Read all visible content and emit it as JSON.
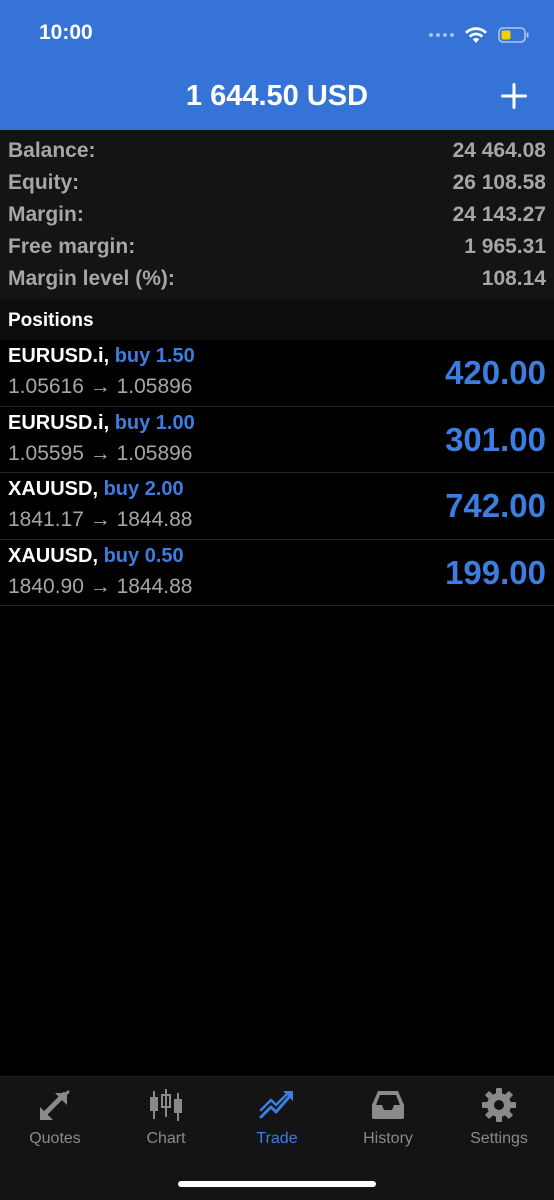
{
  "status_bar": {
    "time": "10:00"
  },
  "header": {
    "title": "1 644.50 USD",
    "add_icon": "plus-icon"
  },
  "summary": [
    {
      "label": "Balance:",
      "value": "24 464.08"
    },
    {
      "label": "Equity:",
      "value": "26 108.58"
    },
    {
      "label": "Margin:",
      "value": "24 143.27"
    },
    {
      "label": "Free margin:",
      "value": "1 965.31"
    },
    {
      "label": "Margin level (%):",
      "value": "108.14"
    }
  ],
  "positions": {
    "title": "Positions",
    "items": [
      {
        "symbol": "EURUSD.i,",
        "side": "buy 1.50",
        "prices": "1.05616 → 1.05896",
        "profit": "420.00"
      },
      {
        "symbol": "EURUSD.i,",
        "side": "buy 1.00",
        "prices": "1.05595 → 1.05896",
        "profit": "301.00"
      },
      {
        "symbol": "XAUUSD,",
        "side": "buy 2.00",
        "prices": "1841.17 → 1844.88",
        "profit": "742.00"
      },
      {
        "symbol": "XAUUSD,",
        "side": "buy 0.50",
        "prices": "1840.90 → 1844.88",
        "profit": "199.00"
      }
    ]
  },
  "tabs": [
    {
      "label": "Quotes",
      "icon": "quotes-arrows-icon"
    },
    {
      "label": "Chart",
      "icon": "candlestick-chart-icon"
    },
    {
      "label": "Trade",
      "icon": "trade-trend-icon",
      "active": true
    },
    {
      "label": "History",
      "icon": "inbox-tray-icon"
    },
    {
      "label": "Settings",
      "icon": "gear-icon"
    }
  ],
  "colors": {
    "header_blue": "#3574d6",
    "accent_blue": "#3d7de0",
    "label_gray": "#a6a6a6",
    "background": "#000000"
  }
}
